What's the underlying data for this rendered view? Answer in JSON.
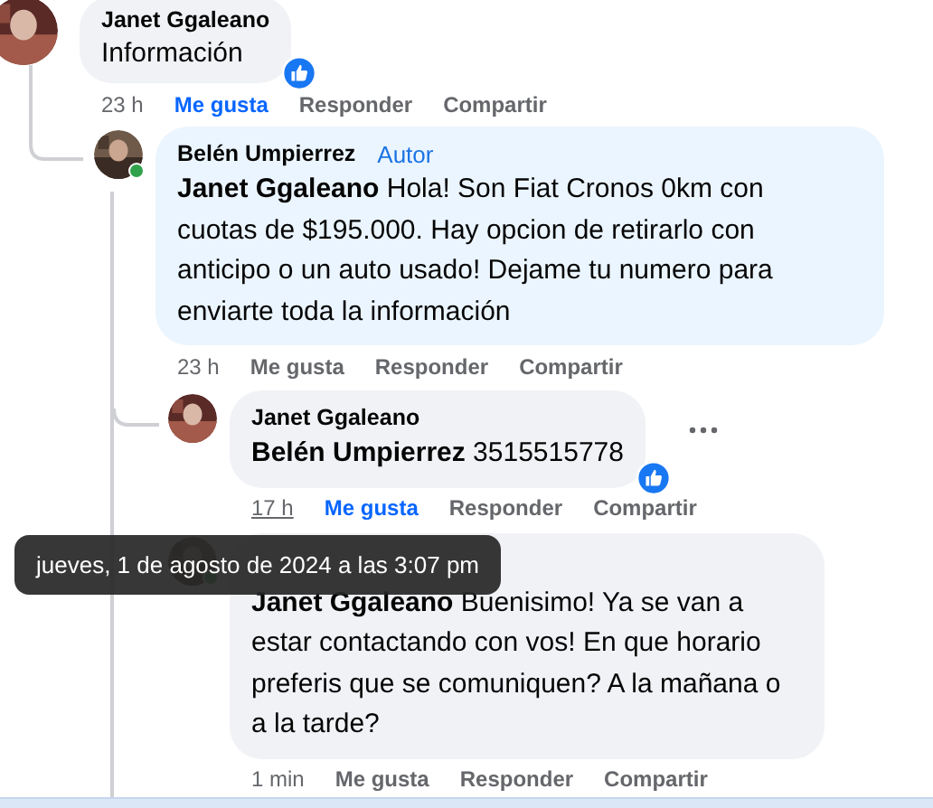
{
  "comments": [
    {
      "author": "Janet Ggaleano",
      "online": false,
      "text": "Información",
      "liked_reaction": true,
      "more_menu": false,
      "time": "23 h",
      "time_hovered": false,
      "liked": true,
      "actions": [
        "Me gusta",
        "Responder",
        "Compartir"
      ],
      "children": [
        {
          "author": "Belén Umpierrez",
          "author_badge": "Autor",
          "online": true,
          "text": "**Janet Ggaleano** Hola! Son Fiat Cronos 0km con cuotas de $195.000. Hay opcion de retirarlo con anticipo o un auto usado! Dejame tu numero para enviarte toda la información",
          "liked_reaction": false,
          "more_menu": false,
          "time": "23 h",
          "time_hovered": false,
          "liked": false,
          "actions": [
            "Me gusta",
            "Responder",
            "Compartir"
          ],
          "children": [
            {
              "author": "Janet Ggaleano",
              "online": false,
              "text": "**Belén Umpierrez** 3515515778",
              "liked_reaction": true,
              "more_menu": true,
              "time": "17 h",
              "time_hovered": true,
              "liked": true,
              "actions": [
                "Me gusta",
                "Responder",
                "Compartir"
              ]
            },
            {
              "online": true,
              "text": "**Janet Ggaleano** Buenisimo! Ya se van a estar contactando con vos! En que horario preferis que se comuniquen? A la mañana o a la tarde?",
              "liked_reaction": false,
              "more_menu": false,
              "time": "1 min",
              "time_hovered": false,
              "liked": false,
              "actions": [
                "Me gusta",
                "Responder",
                "Compartir"
              ]
            }
          ]
        }
      ]
    }
  ],
  "tooltip": {
    "text": "jueves, 1 de agosto de 2024 a las 3:07 pm"
  }
}
